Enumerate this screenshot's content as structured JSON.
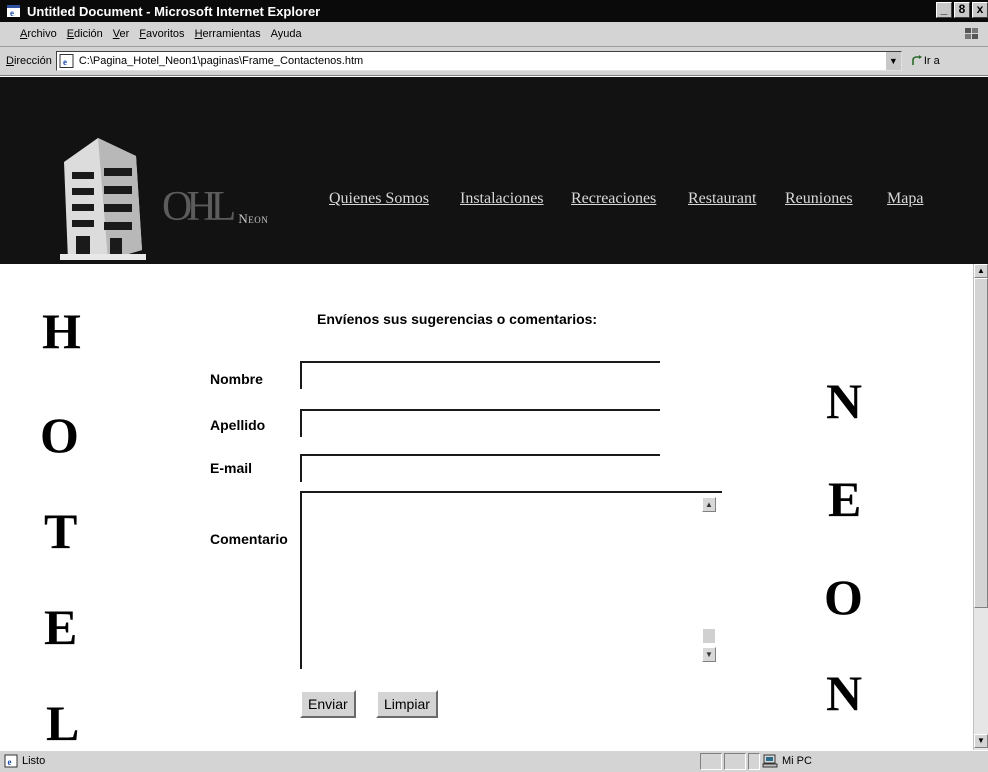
{
  "window": {
    "title": "Untitled Document - Microsoft Internet Explorer",
    "controls": [
      "_",
      "8",
      "x"
    ]
  },
  "menu": {
    "items": [
      {
        "accel": "A",
        "rest": "rchivo"
      },
      {
        "accel": "E",
        "rest": "dición"
      },
      {
        "accel": "V",
        "rest": "er"
      },
      {
        "accel": "F",
        "rest": "avoritos"
      },
      {
        "accel": "H",
        "rest": "erramientas"
      },
      {
        "accel": "",
        "rest": "Ayuda"
      }
    ]
  },
  "address": {
    "label_accel": "D",
    "label_rest": "irección",
    "url": "C:\\Pagina_Hotel_Neon1\\paginas\\Frame_Contactenos.htm",
    "go_label": "Ir a"
  },
  "site": {
    "logo_letters": "OHL",
    "logo_word": "Neon",
    "nav": [
      "Quienes Somos",
      "Instalaciones",
      "Recreaciones",
      "Restaurant",
      "Reuniones",
      "Mapa"
    ]
  },
  "side_left": [
    "H",
    "O",
    "T",
    "E",
    "L"
  ],
  "side_right": [
    "N",
    "E",
    "O",
    "N"
  ],
  "form": {
    "title": "Envíenos sus sugerencias o comentarios:",
    "labels": {
      "nombre": "Nombre",
      "apellido": "Apellido",
      "email": "E-mail",
      "comentario": "Comentario"
    },
    "values": {
      "nombre": "",
      "apellido": "",
      "email": "",
      "comentario": ""
    },
    "buttons": {
      "enviar": "Enviar",
      "limpiar": "Limpiar"
    }
  },
  "status": {
    "text": "Listo",
    "zone": "Mi PC"
  },
  "colors": {
    "titlebar": "#0a0a0a",
    "chrome": "#d4d4d4",
    "header": "#121212",
    "nav_link": "#d8d8d8"
  }
}
